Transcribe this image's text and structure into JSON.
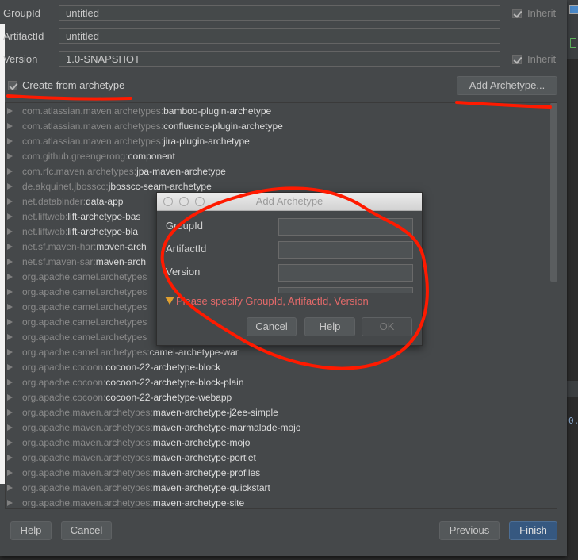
{
  "form": {
    "group_id_label": "GroupId",
    "group_id_value": "untitled",
    "artifact_id_label": "ArtifactId",
    "artifact_id_value": "untitled",
    "version_label": "Version",
    "version_value": "1.0-SNAPSHOT",
    "inherit_label": "Inherit",
    "group_inherit_checked": true,
    "version_inherit_checked": true
  },
  "archetype": {
    "create_from_label_pre": "Create from ",
    "create_from_label_mnemonic": "a",
    "create_from_label_post": "rchetype",
    "create_from_checked": true,
    "add_button_pre": "A",
    "add_button_mnemonic": "d",
    "add_button_post": "d Archetype..."
  },
  "archetypes": [
    {
      "group": "com.atlassian.maven.archetypes:",
      "artifact": "bamboo-plugin-archetype"
    },
    {
      "group": "com.atlassian.maven.archetypes:",
      "artifact": "confluence-plugin-archetype"
    },
    {
      "group": "com.atlassian.maven.archetypes:",
      "artifact": "jira-plugin-archetype"
    },
    {
      "group": "com.github.greengerong:",
      "artifact": "component"
    },
    {
      "group": "com.rfc.maven.archetypes:",
      "artifact": "jpa-maven-archetype"
    },
    {
      "group": "de.akquinet.jbosscc:",
      "artifact": "jbosscc-seam-archetype"
    },
    {
      "group": "net.databinder:",
      "artifact": "data-app"
    },
    {
      "group": "net.liftweb:",
      "artifact": "lift-archetype-bas"
    },
    {
      "group": "net.liftweb:",
      "artifact": "lift-archetype-bla"
    },
    {
      "group": "net.sf.maven-har:",
      "artifact": "maven-arch"
    },
    {
      "group": "net.sf.maven-sar:",
      "artifact": "maven-arch"
    },
    {
      "group": "org.apache.camel.archetypes",
      "artifact": ""
    },
    {
      "group": "org.apache.camel.archetypes",
      "artifact": ""
    },
    {
      "group": "org.apache.camel.archetypes",
      "artifact": ""
    },
    {
      "group": "org.apache.camel.archetypes",
      "artifact": ""
    },
    {
      "group": "org.apache.camel.archetypes",
      "artifact": ""
    },
    {
      "group": "org.apache.camel.archetypes:",
      "artifact": "camel-archetype-war"
    },
    {
      "group": "org.apache.cocoon:",
      "artifact": "cocoon-22-archetype-block"
    },
    {
      "group": "org.apache.cocoon:",
      "artifact": "cocoon-22-archetype-block-plain"
    },
    {
      "group": "org.apache.cocoon:",
      "artifact": "cocoon-22-archetype-webapp"
    },
    {
      "group": "org.apache.maven.archetypes:",
      "artifact": "maven-archetype-j2ee-simple"
    },
    {
      "group": "org.apache.maven.archetypes:",
      "artifact": "maven-archetype-marmalade-mojo"
    },
    {
      "group": "org.apache.maven.archetypes:",
      "artifact": "maven-archetype-mojo"
    },
    {
      "group": "org.apache.maven.archetypes:",
      "artifact": "maven-archetype-portlet"
    },
    {
      "group": "org.apache.maven.archetypes:",
      "artifact": "maven-archetype-profiles"
    },
    {
      "group": "org.apache.maven.archetypes:",
      "artifact": "maven-archetype-quickstart"
    },
    {
      "group": "org.apache.maven.archetypes:",
      "artifact": "maven-archetype-site"
    }
  ],
  "add_dialog": {
    "title": "Add Archetype",
    "group_id_label": "GroupId",
    "artifact_id_label": "ArtifactId",
    "version_label": "Version",
    "group_id_value": "",
    "artifact_id_value": "",
    "version_value": "",
    "error_icon": "warning-icon",
    "error_text": "Please specify GroupId, ArtifactId, Version",
    "cancel_label": "Cancel",
    "help_label": "Help",
    "ok_label": "OK"
  },
  "footer": {
    "help_label": "Help",
    "cancel_label": "Cancel",
    "previous_mnemonic": "P",
    "previous_rest": "revious",
    "finish_mnemonic": "F",
    "finish_rest": "inish"
  },
  "background": {
    "editor_text": "0."
  },
  "colors": {
    "annotation_red": "#ff1a00",
    "error_text": "#e56a6a",
    "primary_button": "#365880"
  }
}
